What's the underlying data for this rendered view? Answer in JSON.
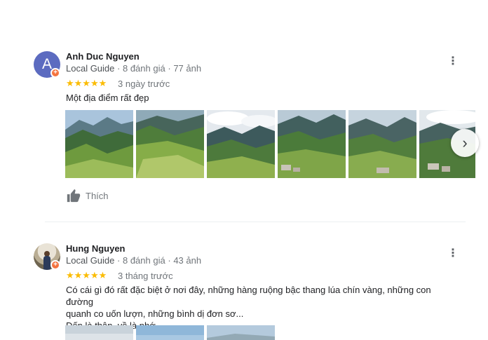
{
  "reviews": [
    {
      "avatar_letter": "A",
      "name": "Anh Duc Nguyen",
      "guide_label": "Local Guide",
      "review_count": "8 đánh giá",
      "photo_count": "77 ảnh",
      "rating": 5,
      "stars": "★★★★★",
      "time": "3 ngày trước",
      "text": "Một địa điểm rất đẹp",
      "like_label": "Thích",
      "photo_count_shown": 6
    },
    {
      "name": "Hung Nguyen",
      "guide_label": "Local Guide",
      "review_count": "8 đánh giá",
      "photo_count": "43 ảnh",
      "rating": 5,
      "stars": "★★★★★",
      "time": "3 tháng trước",
      "text_line1": "Có cái gì đó rất đặc biệt ở nơi đây, những hàng ruộng bậc thang lúa chín vàng, những con đường",
      "text_line2": "quanh co uốn lượn, những bình dị đơn sơ...",
      "text_line3": "Đến là thân, về là nhớ.",
      "photo_count_shown": 3
    }
  ],
  "separators": {
    "dot": "·"
  },
  "icons": {
    "more": "more-vert-icon",
    "next": "chevron-right-icon",
    "like": "thumb-up-icon",
    "badge": "local-guide-badge-icon"
  },
  "colors": {
    "star": "#fbbc04",
    "avatar_bg": "#5c6bc0",
    "guide_badge": "#f4733f",
    "meta_text": "#70757a"
  }
}
